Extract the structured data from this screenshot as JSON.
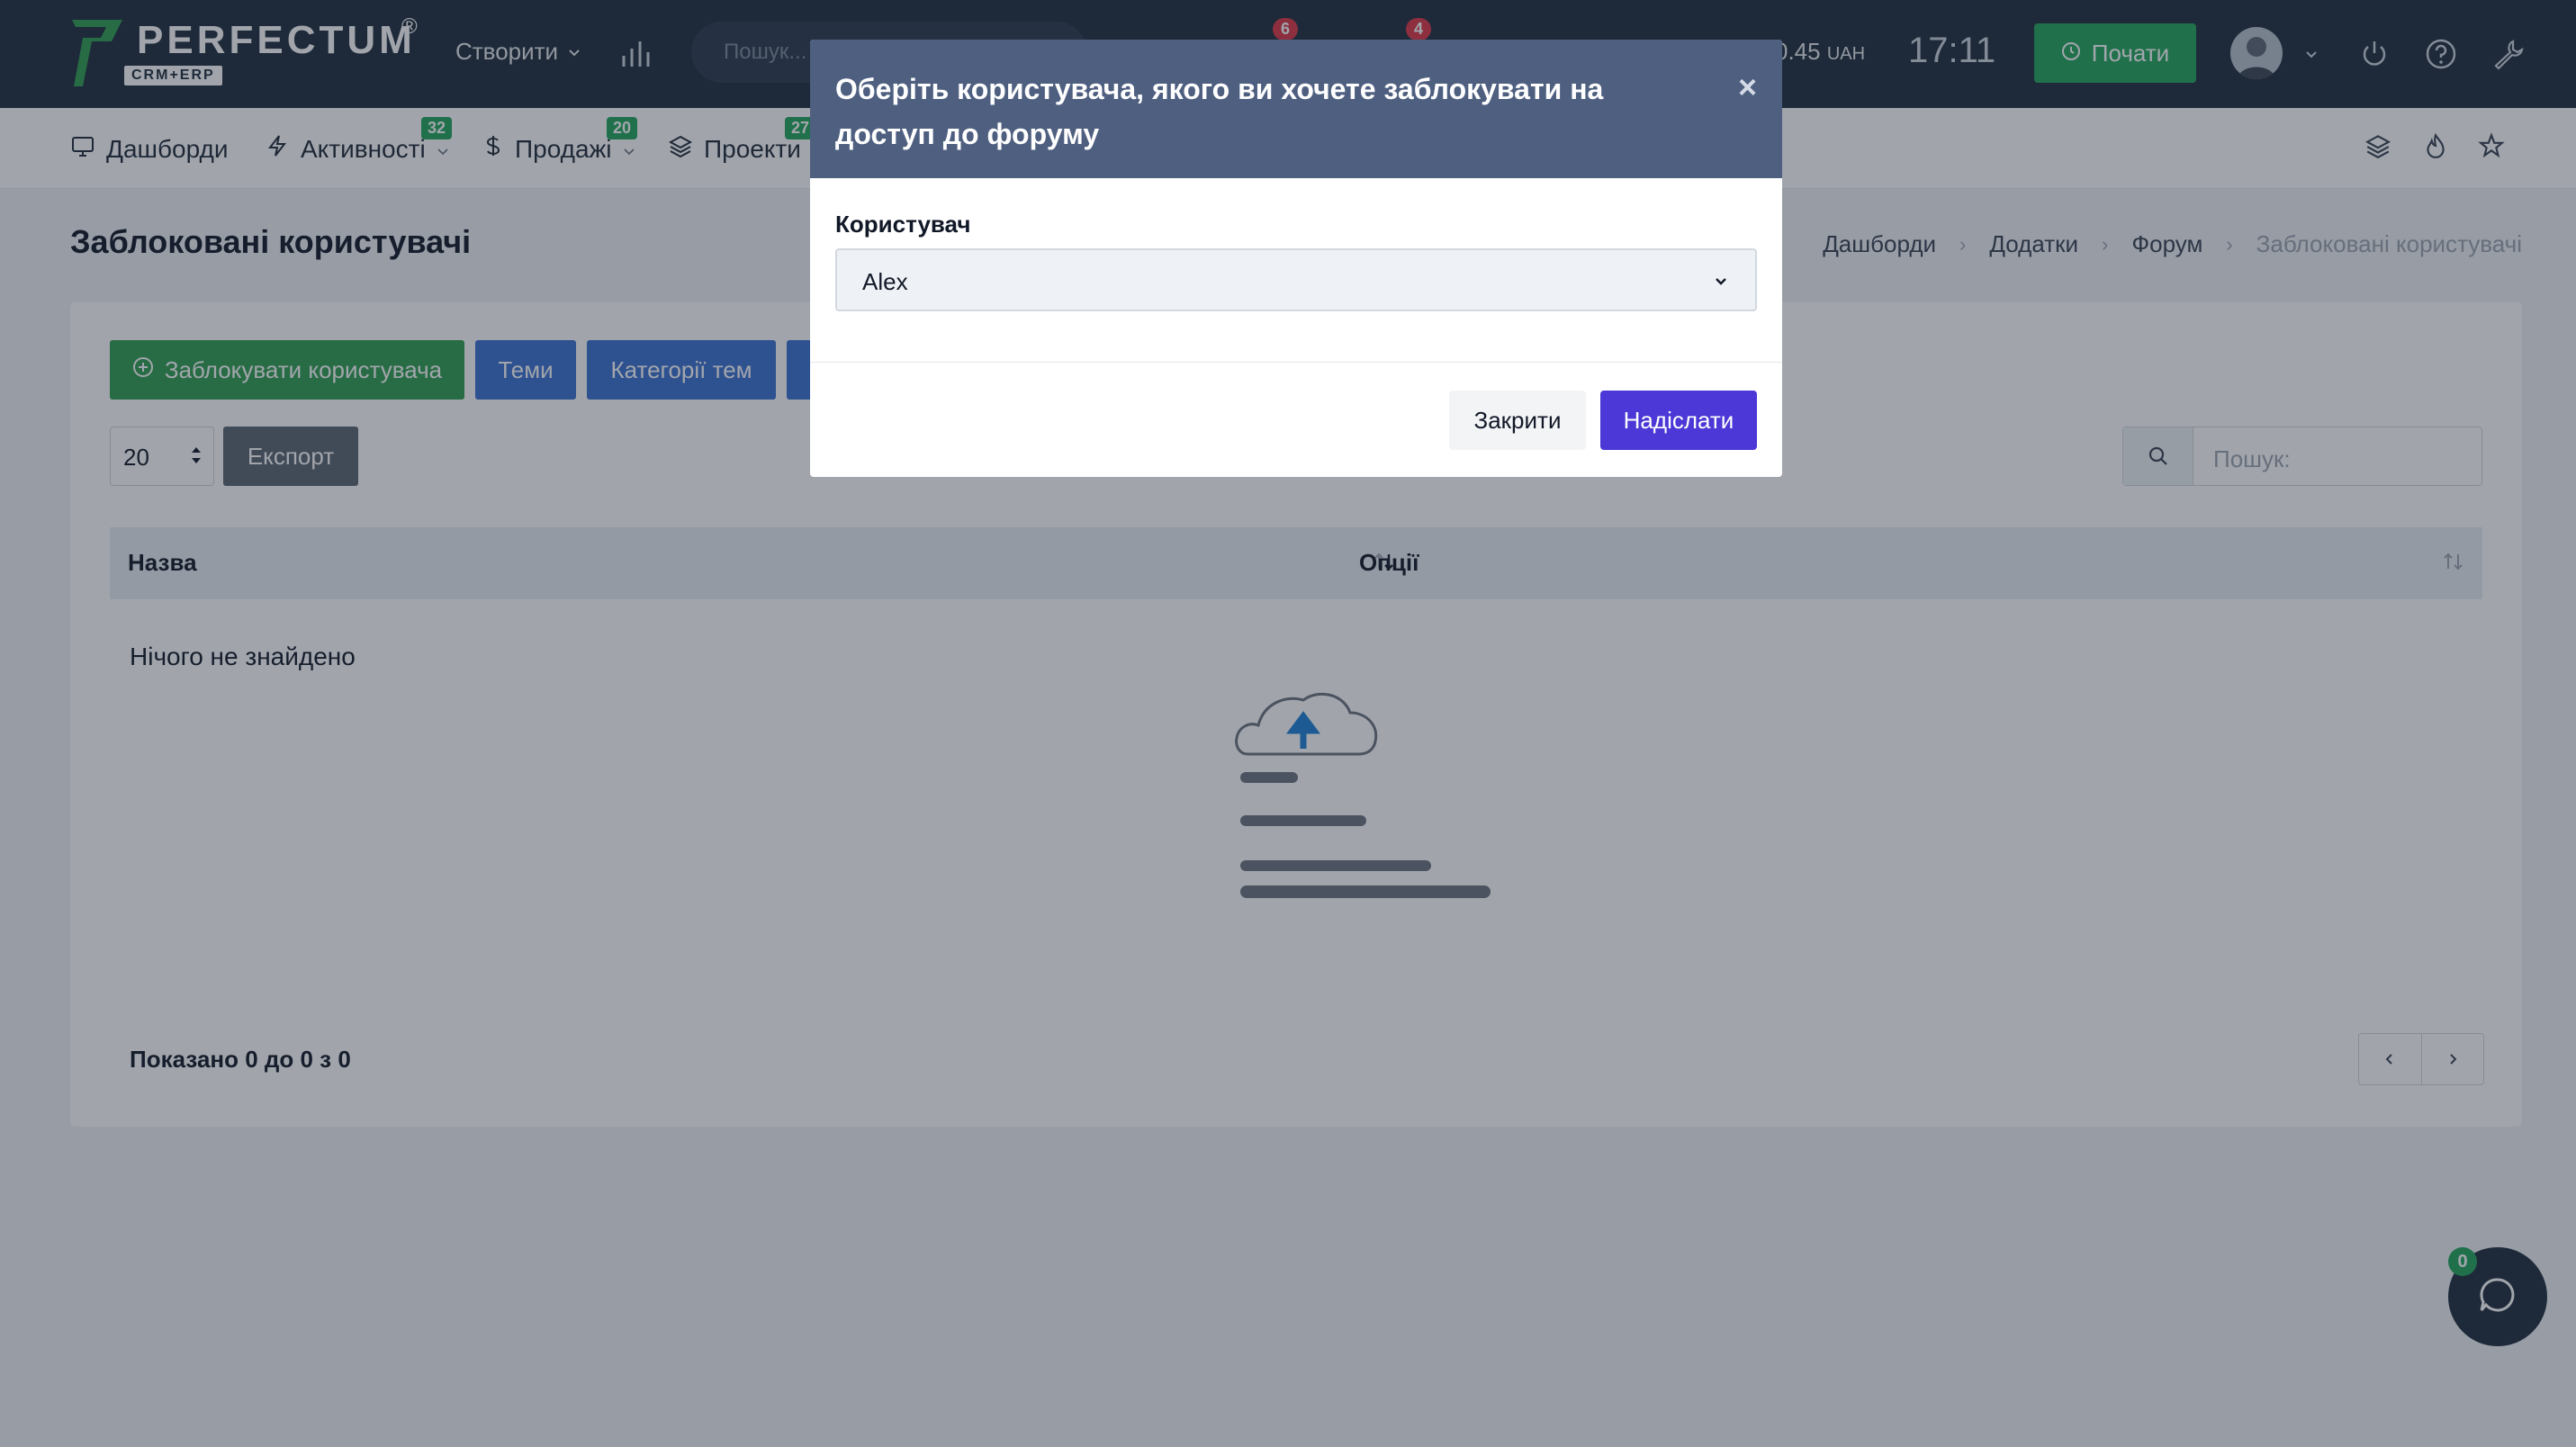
{
  "brand": {
    "name": "PERFECTUM",
    "sub": "CRM+ERP",
    "reg": "®"
  },
  "topbar": {
    "create_label": "Створити",
    "search_placeholder": "Пошук...",
    "badge_1": "6",
    "badge_2": "4",
    "money_value": "0.45",
    "money_unit": "UAH",
    "clock": "17:11",
    "start_label": "Почати"
  },
  "nav": {
    "items": [
      {
        "label": "Дашборди",
        "icon": "monitor-icon"
      },
      {
        "label": "Активності",
        "icon": "lightning-icon",
        "badge": "32"
      },
      {
        "label": "Продажі",
        "icon": "dollar-icon",
        "badge": "20"
      },
      {
        "label": "Проекти",
        "icon": "layers-icon",
        "badge": "27"
      }
    ]
  },
  "page": {
    "title": "Заблоковані користувачі",
    "breadcrumb": [
      "Дашборди",
      "Додатки",
      "Форум",
      "Заблоковані користувачі"
    ]
  },
  "toolbar": {
    "block_user_label": "Заблокувати користувача",
    "topics_label": "Теми",
    "topic_categories_label": "Категорії тем",
    "page_size": "20",
    "export_label": "Експорт",
    "search_placeholder": "Пошук:"
  },
  "table": {
    "columns": [
      "Назва",
      "Опції"
    ],
    "empty_text": "Нічого не знайдено",
    "info": "Показано 0 до 0 з 0"
  },
  "chat": {
    "badge": "0"
  },
  "modal": {
    "title": "Оберіть користувача, якого ви хочете заблокувати на доступ до форуму",
    "close_glyph": "×",
    "field_label": "Користувач",
    "selected_user": "Alex",
    "close_label": "Закрити",
    "submit_label": "Надіслати"
  },
  "colors": {
    "topbar": "#1e2b3c",
    "modal_header": "#4e5f80",
    "submit": "#4b38d6",
    "start": "#22a55b",
    "primary_blue": "#3a6fd1"
  }
}
